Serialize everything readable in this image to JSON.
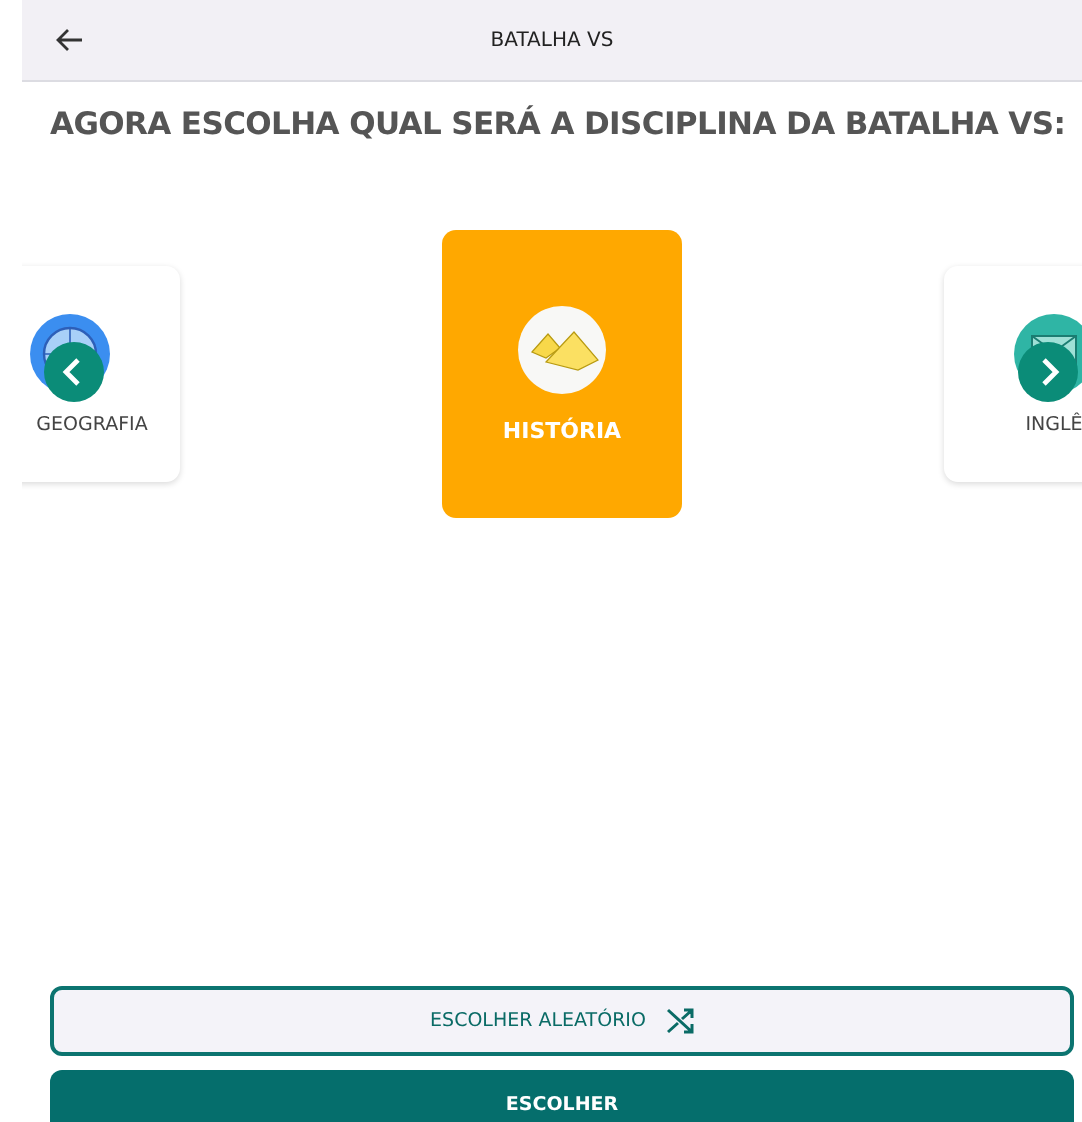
{
  "header": {
    "title": "BATALHA VS"
  },
  "heading": "AGORA ESCOLHA QUAL SERÁ A DISCIPLINA DA BATALHA VS:",
  "subjects": [
    {
      "name": "GEOGRAFIA",
      "kind": "globe",
      "selected": false
    },
    {
      "name": "HISTÓRIA",
      "kind": "pyramids",
      "selected": true
    },
    {
      "name": "INGLÊ",
      "kind": "flag",
      "selected": false
    }
  ],
  "buttons": {
    "random": "ESCOLHER ALEATÓRIO",
    "choose": "ESCOLHER"
  }
}
